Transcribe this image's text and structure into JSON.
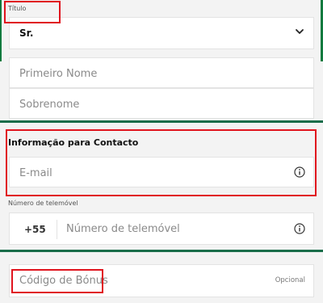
{
  "title_field": {
    "label": "Título",
    "value": "Sr."
  },
  "name_fields": {
    "first_name_placeholder": "Primeiro Nome",
    "last_name_placeholder": "Sobrenome"
  },
  "contact_section": {
    "title": "Informação para Contacto",
    "email_placeholder": "E-mail"
  },
  "phone": {
    "label": "Número de telemóvel",
    "prefix": "+55",
    "placeholder": "Número de telemóvel"
  },
  "bonus": {
    "placeholder": "Código de Bónus",
    "optional_label": "Opcional"
  },
  "colors": {
    "accent_green": "#1a6d4a",
    "highlight_red": "#e0141e"
  },
  "icons": [
    "chevron-down-icon",
    "info-icon"
  ]
}
